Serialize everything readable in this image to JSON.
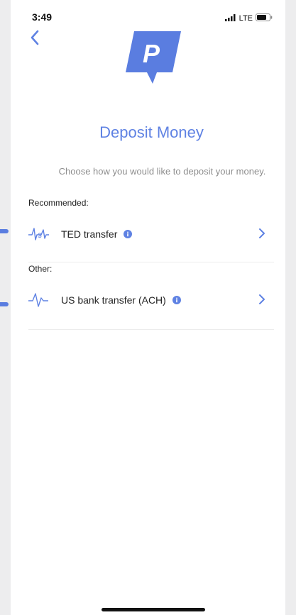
{
  "status_bar": {
    "time": "3:49",
    "network": "LTE"
  },
  "header": {
    "back_icon": "chevron-left-icon",
    "logo_letter": "P"
  },
  "page": {
    "title": "Deposit Money",
    "subtitle": "Choose how you would like to deposit your money."
  },
  "sections": {
    "recommended": {
      "label": "Recommended:",
      "option_label": "TED transfer",
      "option_icon": "dollar-pulse-icon"
    },
    "other": {
      "label": "Other:",
      "option_label": "US bank transfer (ACH)",
      "option_icon": "pulse-icon"
    }
  },
  "colors": {
    "accent": "#5f82e3",
    "logo": "#5a7de0",
    "subtitle": "#8d8d8d"
  }
}
